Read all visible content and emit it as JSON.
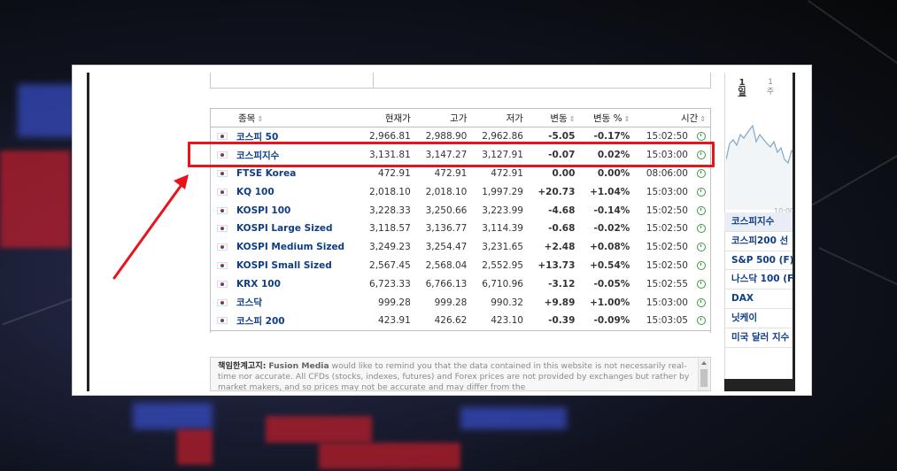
{
  "table": {
    "headers": {
      "name": "종목",
      "last": "현재가",
      "high": "고가",
      "low": "저가",
      "chg": "변동",
      "chg_pct": "변동 %",
      "time": "시간"
    },
    "sort_glyph": "⇕",
    "rows": [
      {
        "name": "코스피 50",
        "last": "2,966.81",
        "high": "2,988.90",
        "low": "2,962.86",
        "chg": "-5.05",
        "chg_pct": "-0.17%",
        "time": "15:02:50",
        "dir": "neg"
      },
      {
        "name": "코스피지수",
        "last": "3,131.81",
        "high": "3,147.27",
        "low": "3,127.91",
        "chg": "-0.07",
        "chg_pct": "0.02%",
        "time": "15:03:00",
        "dir": "neg"
      },
      {
        "name": "FTSE Korea",
        "last": "472.91",
        "high": "472.91",
        "low": "472.91",
        "chg": "0.00",
        "chg_pct": "0.00%",
        "time": "08:06:00",
        "dir": "neu"
      },
      {
        "name": "KQ 100",
        "last": "2,018.10",
        "high": "2,018.10",
        "low": "1,997.29",
        "chg": "+20.73",
        "chg_pct": "+1.04%",
        "time": "15:03:00",
        "dir": "pos"
      },
      {
        "name": "KOSPI 100",
        "last": "3,228.33",
        "high": "3,250.66",
        "low": "3,223.99",
        "chg": "-4.68",
        "chg_pct": "-0.14%",
        "time": "15:02:50",
        "dir": "neg"
      },
      {
        "name": "KOSPI Large Sized",
        "last": "3,118.57",
        "high": "3,136.77",
        "low": "3,114.39",
        "chg": "-0.68",
        "chg_pct": "-0.02%",
        "time": "15:02:50",
        "dir": "neg"
      },
      {
        "name": "KOSPI Medium Sized",
        "last": "3,249.23",
        "high": "3,254.47",
        "low": "3,231.65",
        "chg": "+2.48",
        "chg_pct": "+0.08%",
        "time": "15:02:50",
        "dir": "pos"
      },
      {
        "name": "KOSPI Small Sized",
        "last": "2,567.45",
        "high": "2,568.04",
        "low": "2,552.95",
        "chg": "+13.73",
        "chg_pct": "+0.54%",
        "time": "15:02:50",
        "dir": "pos"
      },
      {
        "name": "KRX 100",
        "last": "6,723.33",
        "high": "6,766.13",
        "low": "6,710.96",
        "chg": "-3.12",
        "chg_pct": "-0.05%",
        "time": "15:02:55",
        "dir": "neg"
      },
      {
        "name": "코스닥",
        "last": "999.28",
        "high": "999.28",
        "low": "990.32",
        "chg": "+9.89",
        "chg_pct": "+1.00%",
        "time": "15:03:00",
        "dir": "pos"
      },
      {
        "name": "코스피 200",
        "last": "423.91",
        "high": "426.62",
        "low": "423.10",
        "chg": "-0.39",
        "chg_pct": "-0.09%",
        "time": "15:03:05",
        "dir": "neg"
      }
    ]
  },
  "disclaimer": {
    "label": "책임한계고지:",
    "brand": "Fusion Media",
    "text": " would like to remind you that the data contained in this website is not necessarily real-time nor accurate. All CFDs (stocks, indexes, futures) and Forex prices are not provided by exchanges but rather by market makers, and so prices may not be accurate and may differ from the"
  },
  "right_panel": {
    "tab_1": "1\n일",
    "tab_2": "1\n주",
    "chart_tick": "10:00",
    "items": [
      "코스피지수",
      "코스피200 선",
      "S&P 500 (F)",
      "나스닥 100 (F",
      "DAX",
      "닛케이",
      "미국 달러 지수"
    ]
  },
  "colors": {
    "highlight": "#e8141c",
    "positive": "#e0101e",
    "negative": "#2a72d6",
    "link": "#0f3d86"
  }
}
